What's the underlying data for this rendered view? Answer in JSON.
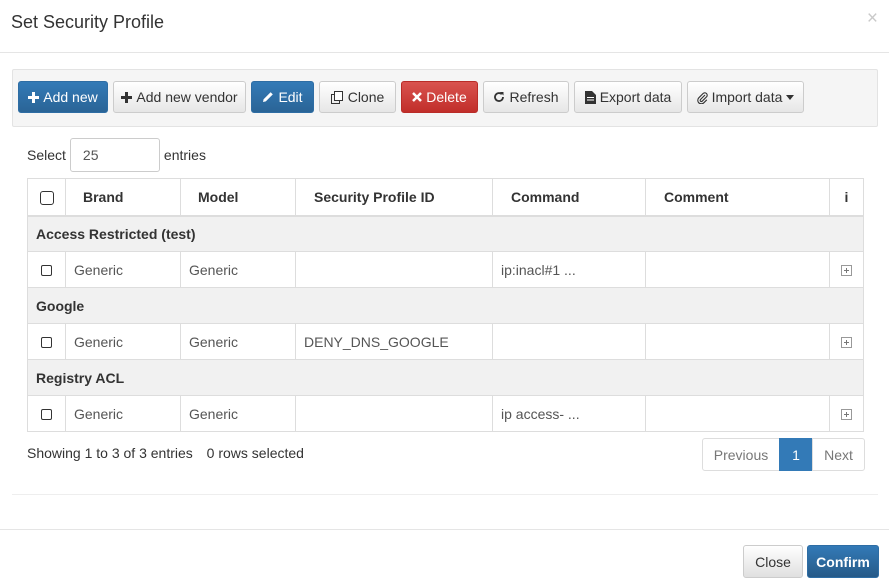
{
  "modal": {
    "title": "Set Security Profile",
    "close_symbol": "×"
  },
  "toolbar": {
    "add_new": "Add new",
    "add_new_vendor": "Add new vendor",
    "edit": "Edit",
    "clone": "Clone",
    "delete": "Delete",
    "refresh": "Refresh",
    "export_data": "Export data",
    "import_data": "Import data"
  },
  "length": {
    "label_before": "Select",
    "value": "25",
    "label_after": "entries"
  },
  "table": {
    "headers": [
      "Brand",
      "Model",
      "Security Profile ID",
      "Command",
      "Comment",
      "i"
    ],
    "groups": [
      {
        "name": "Access Restricted (test)",
        "row": {
          "brand": "Generic",
          "model": "Generic",
          "profile_id": "",
          "command": "ip:inacl#1 ...",
          "comment": ""
        }
      },
      {
        "name": "Google",
        "row": {
          "brand": "Generic",
          "model": "Generic",
          "profile_id": "DENY_DNS_GOOGLE",
          "command": "",
          "comment": ""
        }
      },
      {
        "name": "Registry ACL",
        "row": {
          "brand": "Generic",
          "model": "Generic",
          "profile_id": "",
          "command": "ip access- ...",
          "comment": ""
        }
      }
    ]
  },
  "info": {
    "showing": "Showing 1 to 3 of 3 entries",
    "selected": "0 rows selected"
  },
  "pagination": {
    "previous": "Previous",
    "current": "1",
    "next": "Next"
  },
  "footer": {
    "close": "Close",
    "confirm": "Confirm"
  },
  "colors": {
    "primary": "#337ab7",
    "danger": "#d9534f",
    "toolbar_bg": "#f5f5f5"
  }
}
